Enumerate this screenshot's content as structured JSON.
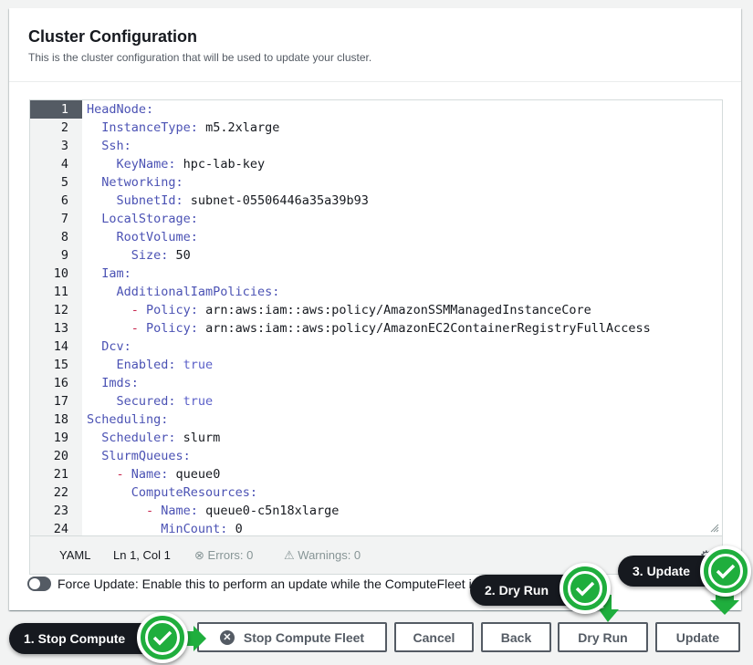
{
  "panel": {
    "title": "Cluster Configuration",
    "description": "This is the cluster configuration that will be used to update your cluster."
  },
  "editor": {
    "active_line": 1,
    "lines": [
      {
        "n": "1",
        "indent": "",
        "key": "HeadNode:",
        "val": ""
      },
      {
        "n": "2",
        "indent": "  ",
        "key": "InstanceType:",
        "val": " m5.2xlarge"
      },
      {
        "n": "3",
        "indent": "  ",
        "key": "Ssh:",
        "val": ""
      },
      {
        "n": "4",
        "indent": "    ",
        "key": "KeyName:",
        "val": " hpc-lab-key"
      },
      {
        "n": "5",
        "indent": "  ",
        "key": "Networking:",
        "val": ""
      },
      {
        "n": "6",
        "indent": "    ",
        "key": "SubnetId:",
        "val": " subnet-05506446a35a39b93"
      },
      {
        "n": "7",
        "indent": "  ",
        "key": "LocalStorage:",
        "val": ""
      },
      {
        "n": "8",
        "indent": "    ",
        "key": "RootVolume:",
        "val": ""
      },
      {
        "n": "9",
        "indent": "      ",
        "key": "Size:",
        "num": " 50"
      },
      {
        "n": "10",
        "indent": "  ",
        "key": "Iam:",
        "val": ""
      },
      {
        "n": "11",
        "indent": "    ",
        "key": "AdditionalIamPolicies:",
        "val": ""
      },
      {
        "n": "12",
        "indent": "      ",
        "dash": "- ",
        "key": "Policy:",
        "val": " arn:aws:iam::aws:policy/AmazonSSMManagedInstanceCore"
      },
      {
        "n": "13",
        "indent": "      ",
        "dash": "- ",
        "key": "Policy:",
        "val": " arn:aws:iam::aws:policy/AmazonEC2ContainerRegistryFullAccess"
      },
      {
        "n": "14",
        "indent": "  ",
        "key": "Dcv:",
        "val": ""
      },
      {
        "n": "15",
        "indent": "    ",
        "key": "Enabled:",
        "bool": " true"
      },
      {
        "n": "16",
        "indent": "  ",
        "key": "Imds:",
        "val": ""
      },
      {
        "n": "17",
        "indent": "    ",
        "key": "Secured:",
        "bool": " true"
      },
      {
        "n": "18",
        "indent": "",
        "key": "Scheduling:",
        "val": ""
      },
      {
        "n": "19",
        "indent": "  ",
        "key": "Scheduler:",
        "val": " slurm"
      },
      {
        "n": "20",
        "indent": "  ",
        "key": "SlurmQueues:",
        "val": ""
      },
      {
        "n": "21",
        "indent": "    ",
        "dash": "- ",
        "key": "Name:",
        "val": " queue0"
      },
      {
        "n": "22",
        "indent": "      ",
        "key": "ComputeResources:",
        "val": ""
      },
      {
        "n": "23",
        "indent": "        ",
        "dash": "- ",
        "key": "Name:",
        "val": " queue0-c5n18xlarge"
      },
      {
        "n": "24",
        "indent": "          ",
        "key": "MinCount:",
        "num": " 0"
      }
    ]
  },
  "status_bar": {
    "language": "YAML",
    "position": "Ln 1, Col 1",
    "errors": "Errors: 0",
    "warnings": "Warnings: 0"
  },
  "force_update": {
    "label": "Force Update: Enable this to perform an update while the ComputeFleet is still running.",
    "enabled": false
  },
  "buttons": {
    "stop_fleet": "Stop Compute Fleet",
    "cancel": "Cancel",
    "back": "Back",
    "dry_run": "Dry Run",
    "update": "Update"
  },
  "callouts": {
    "step1": "1. Stop Compute",
    "step2": "2. Dry Run",
    "step3": "3. Update"
  },
  "colors": {
    "key": "#4b52b4",
    "boolean": "#5a5fc8",
    "check_green": "#1fae3d",
    "callout_bg": "#16191f"
  }
}
